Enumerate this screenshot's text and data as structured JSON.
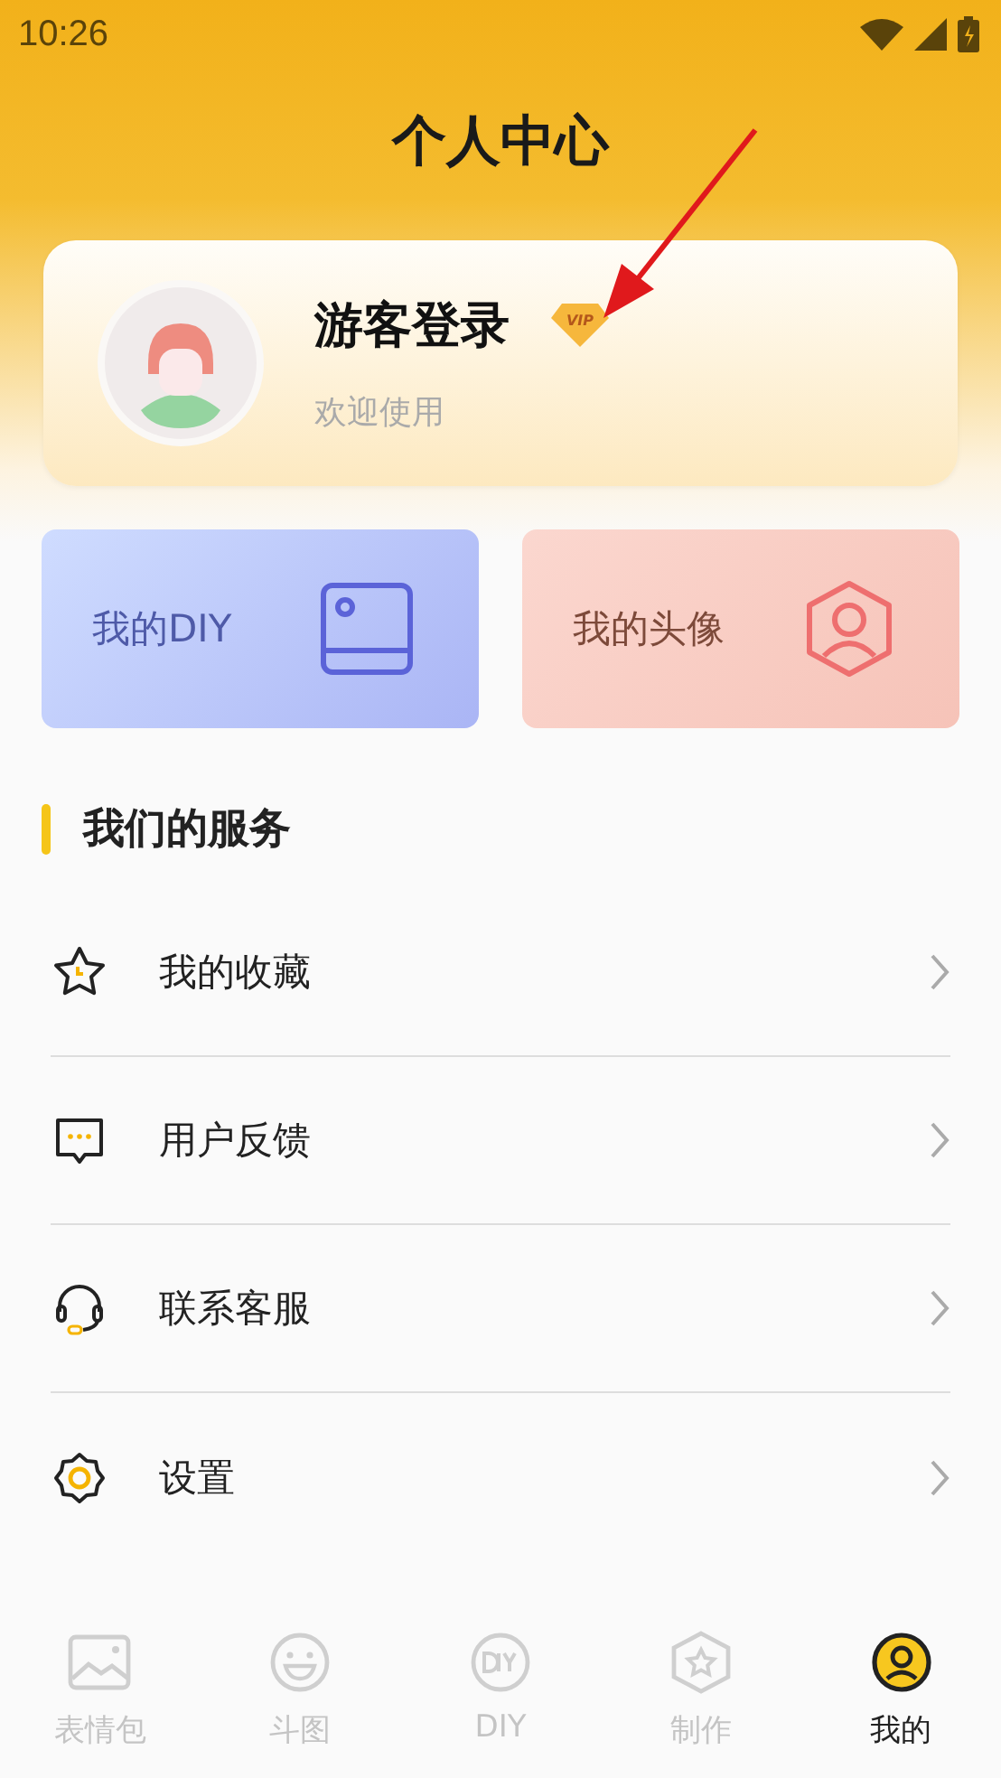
{
  "status_bar": {
    "time": "10:26"
  },
  "header": {
    "title": "个人中心"
  },
  "profile": {
    "name": "游客登录",
    "badge": "VIP",
    "subtitle": "欢迎使用"
  },
  "shortcuts": [
    {
      "label": "我的DIY",
      "kind": "diy"
    },
    {
      "label": "我的头像",
      "kind": "avatar"
    }
  ],
  "section": {
    "title": "我们的服务"
  },
  "menu": [
    {
      "label": "我的收藏",
      "kind": "star"
    },
    {
      "label": "用户反馈",
      "kind": "feedback"
    },
    {
      "label": "联系客服",
      "kind": "support"
    },
    {
      "label": "设置",
      "kind": "settings"
    }
  ],
  "tabs": [
    {
      "label": "表情包",
      "kind": "image",
      "selected": false
    },
    {
      "label": "斗图",
      "kind": "smile",
      "selected": false
    },
    {
      "label": "DIY",
      "kind": "diy",
      "selected": false
    },
    {
      "label": "制作",
      "kind": "hexstar",
      "selected": false
    },
    {
      "label": "我的",
      "kind": "me",
      "selected": true
    }
  ]
}
